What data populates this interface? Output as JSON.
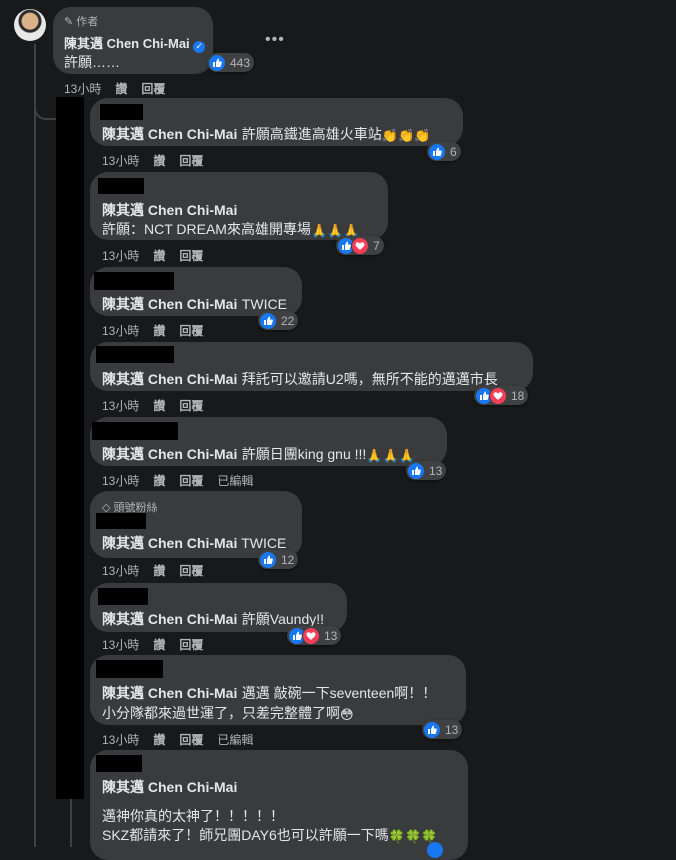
{
  "post": {
    "author_badge": "作者",
    "author": "陳其邁 Chen Chi-Mai",
    "text": "許願……",
    "reactions": "443",
    "time": "13小時",
    "like": "讚",
    "reply": "回覆"
  },
  "replies": [
    {
      "name": "陳其邁 Chen Chi-Mai",
      "text": "許願高鐵進高雄火車站",
      "emoji": "👏👏👏",
      "reactions": "6",
      "time": "13小時",
      "like": "讚",
      "reply": "回覆"
    },
    {
      "name": "陳其邁 Chen Chi-Mai",
      "text": "許願：NCT DREAM來高雄開專場",
      "emoji": "🙏🙏🙏",
      "reactions": "7",
      "time": "13小時",
      "like": "讚",
      "reply": "回覆"
    },
    {
      "name": "陳其邁 Chen Chi-Mai",
      "text": "TWICE",
      "reactions": "22",
      "time": "13小時",
      "like": "讚",
      "reply": "回覆"
    },
    {
      "name": "陳其邁 Chen Chi-Mai",
      "text": "拜託可以邀請U2嗎，無所不能的邁邁市長",
      "reactions": "18",
      "time": "13小時",
      "like": "讚",
      "reply": "回覆"
    },
    {
      "name": "陳其邁 Chen Chi-Mai",
      "text": "許願日團king gnu !!!",
      "emoji": "🙏🙏🙏",
      "reactions": "13",
      "time": "13小時",
      "like": "讚",
      "reply": "回覆",
      "edited": "已編輯"
    },
    {
      "badge": "頭號粉絲",
      "name": "陳其邁 Chen Chi-Mai",
      "text": "TWICE",
      "reactions": "12",
      "time": "13小時",
      "like": "讚",
      "reply": "回覆"
    },
    {
      "name": "陳其邁 Chen Chi-Mai",
      "text": "許願Vaundy!!",
      "reactions": "13",
      "time": "13小時",
      "like": "讚",
      "reply": "回覆"
    },
    {
      "name": "陳其邁 Chen Chi-Mai",
      "text": "邁邁 敲碗一下seventeen啊！！",
      "text2": "小分隊都來過世運了，只差完整體了啊",
      "emoji": "😳",
      "reactions": "13",
      "time": "13小時",
      "like": "讚",
      "reply": "回覆",
      "edited": "已編輯"
    },
    {
      "name": "陳其邁 Chen Chi-Mai",
      "text": "邁神你真的太神了！！！！！",
      "text2": "SKZ都請來了！師兄團DAY6也可以許願一下嗎",
      "emoji": "🍀🍀🍀"
    }
  ],
  "colors": {
    "like": "#1877f2",
    "love": "#f33e58",
    "bubble": "#3a3b3c",
    "bg": "#18191a"
  }
}
